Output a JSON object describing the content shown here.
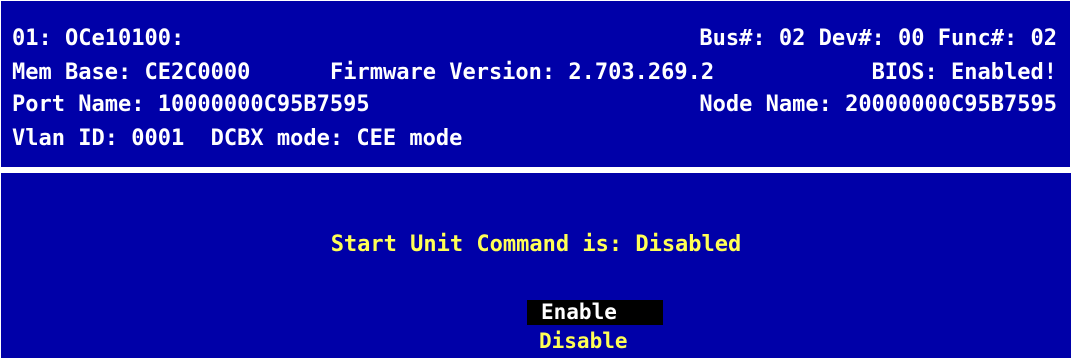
{
  "header": {
    "line1_left": "01: OCe10100:",
    "line1_right": "Bus#: 02 Dev#: 00 Func#: 02",
    "line2_left": "Mem Base: CE2C0000",
    "line2_mid": "Firmware Version: 2.703.269.2",
    "line2_right": "BIOS: Enabled!",
    "line3_left": "Port Name: 10000000C95B7595",
    "line3_right": "Node Name: 20000000C95B7595",
    "line4_left": "Vlan ID: 0001  DCBX mode: CEE mode"
  },
  "main": {
    "status_text": "Start Unit Command is: Disabled",
    "options": [
      {
        "label": "Enable",
        "selected": true
      },
      {
        "label": "Disable",
        "selected": false
      }
    ]
  },
  "colors": {
    "background": "#0000a8",
    "text": "#ffffff",
    "highlight_text": "#ffff55",
    "selected_bg": "#000000"
  }
}
